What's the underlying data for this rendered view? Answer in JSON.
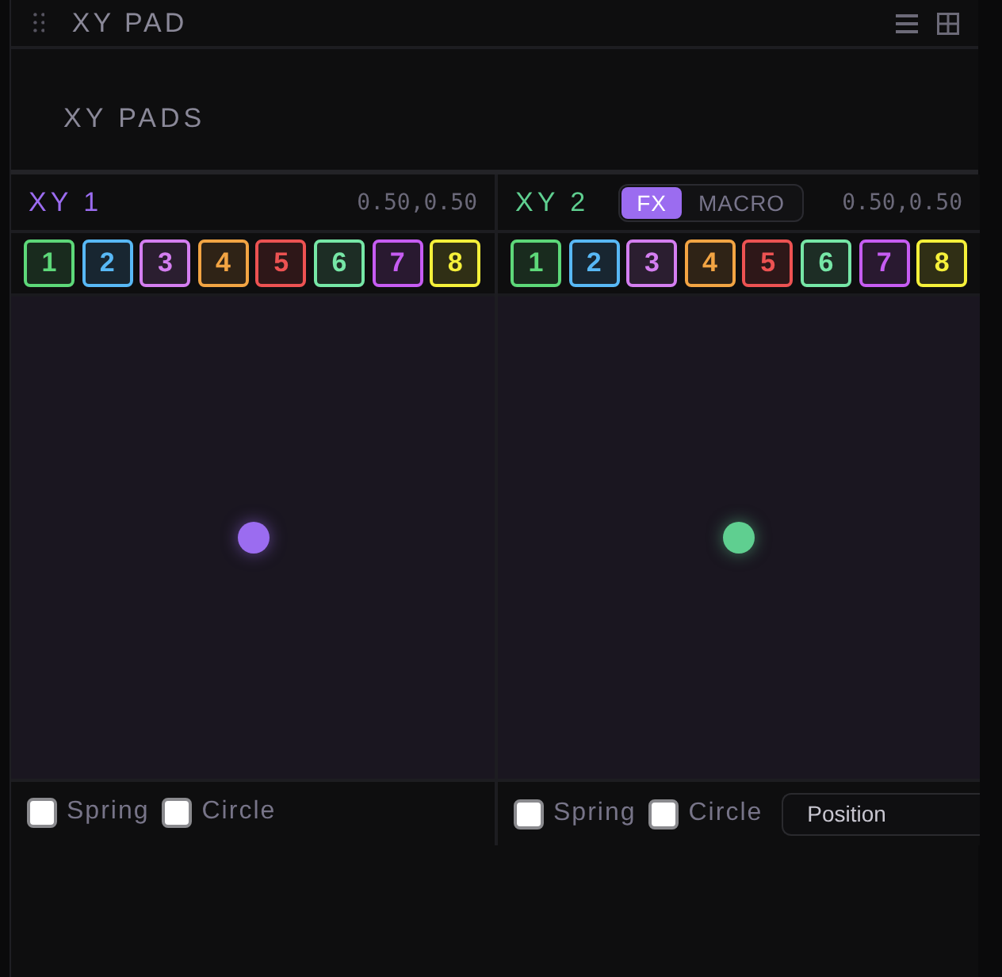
{
  "panel": {
    "title": "XY PAD"
  },
  "section": {
    "title": "XY PADS"
  },
  "pads": [
    {
      "title": "XY 1",
      "color": "#9b6cf0",
      "readout": "0.50,0.50",
      "channels": [
        {
          "label": "1",
          "color": "#5dd879"
        },
        {
          "label": "2",
          "color": "#58b8f5"
        },
        {
          "label": "3",
          "color": "#d47ef0"
        },
        {
          "label": "4",
          "color": "#f2a443"
        },
        {
          "label": "5",
          "color": "#ec5252"
        },
        {
          "label": "6",
          "color": "#76e6a6"
        },
        {
          "label": "7",
          "color": "#c65cf2"
        },
        {
          "label": "8",
          "color": "#f5f03a"
        }
      ],
      "options": [
        {
          "label": "Spring",
          "checked": false
        },
        {
          "label": "Circle",
          "checked": false
        }
      ]
    },
    {
      "title": "XY 2",
      "color": "#5fcf90",
      "mode_toggle": [
        {
          "label": "FX",
          "selected": true
        },
        {
          "label": "MACRO",
          "selected": false
        }
      ],
      "readout": "0.50,0.50",
      "channels": [
        {
          "label": "1",
          "color": "#5dd879"
        },
        {
          "label": "2",
          "color": "#58b8f5"
        },
        {
          "label": "3",
          "color": "#d47ef0"
        },
        {
          "label": "4",
          "color": "#f2a443"
        },
        {
          "label": "5",
          "color": "#ec5252"
        },
        {
          "label": "6",
          "color": "#76e6a6"
        },
        {
          "label": "7",
          "color": "#c65cf2"
        },
        {
          "label": "8",
          "color": "#f5f03a"
        }
      ],
      "options": [
        {
          "label": "Spring",
          "checked": false
        },
        {
          "label": "Circle",
          "checked": false
        }
      ],
      "target_select": {
        "value": "Position"
      }
    }
  ]
}
